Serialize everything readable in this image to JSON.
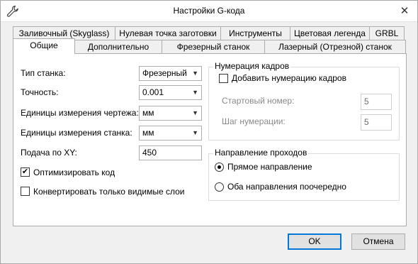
{
  "window": {
    "title": "Настройки G-кода",
    "close_glyph": "✕",
    "icon": "wrench-icon"
  },
  "tabs_row1": [
    "Заливочный (Skyglass)",
    "Нулевая точка заготовки",
    "Инструменты",
    "Цветовая легенда",
    "GRBL"
  ],
  "tabs_row2": [
    "Общие",
    "Дополнительно",
    "Фрезерный станок",
    "Лазерный (Отрезной) станок"
  ],
  "active_tab": "Общие",
  "general": {
    "machine_type_label": "Тип станка:",
    "machine_type_value": "Фрезерный",
    "precision_label": "Точность:",
    "precision_value": "0.001",
    "drawing_units_label": "Единицы измерения чертежа:",
    "drawing_units_value": "мм",
    "machine_units_label": "Единицы измерения станка:",
    "machine_units_value": "мм",
    "feed_xy_label": "Подача по XY:",
    "feed_xy_value": "450",
    "optimize_label": "Оптимизировать код",
    "optimize_checked": true,
    "visible_layers_label": "Конвертировать только видимые слои",
    "visible_layers_checked": false
  },
  "frame_numbering": {
    "title": "Нумерация кадров",
    "add_numbering_label": "Добавить нумерацию кадров",
    "add_numbering_checked": false,
    "start_number_label": "Стартовый номер:",
    "start_number_value": "5",
    "step_label": "Шаг нумерации:",
    "step_value": "5"
  },
  "pass_direction": {
    "title": "Направление проходов",
    "forward_label": "Прямое направление",
    "both_label": "Оба направления поочередно",
    "selected": "forward"
  },
  "buttons": {
    "ok": "OK",
    "cancel": "Отмена"
  },
  "glyphs": {
    "check": "✔",
    "dropdown": "▼"
  }
}
